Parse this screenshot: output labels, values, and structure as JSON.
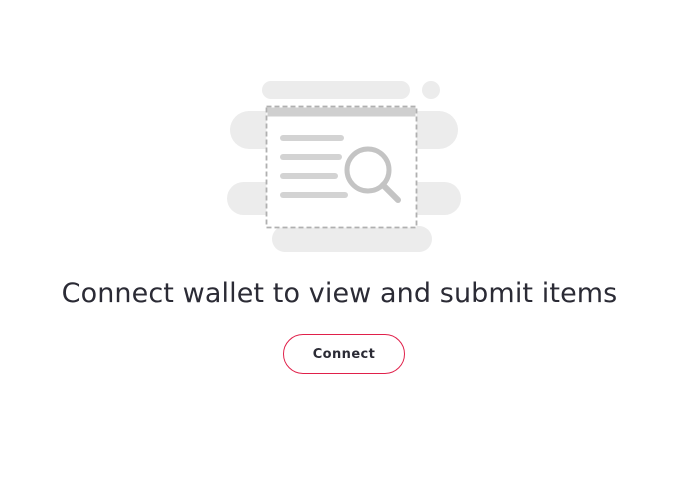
{
  "empty_state": {
    "illustration_icon": "document-search-icon",
    "title": "Connect wallet to view and submit items",
    "connect_button_label": "Connect"
  },
  "colors": {
    "accent": "#e0204a",
    "text": "#2b2b35",
    "illustration_light": "#ececec",
    "illustration_mid": "#c8c8c8"
  }
}
